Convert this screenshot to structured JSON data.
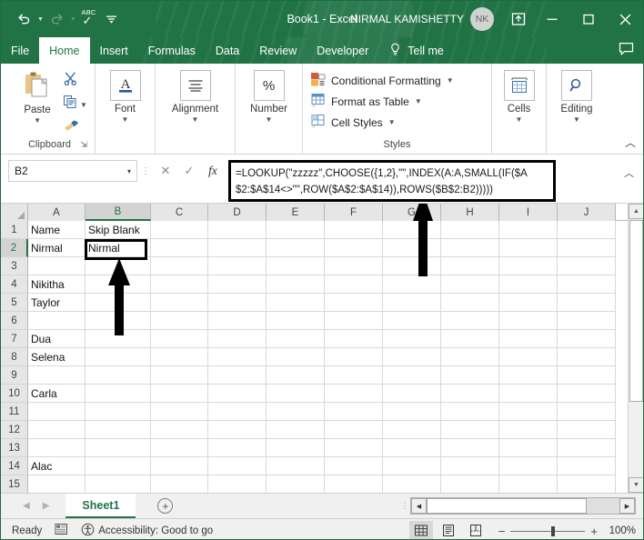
{
  "titlebar": {
    "quick_access": [
      {
        "name": "undo-icon",
        "glyph": "↰"
      },
      {
        "name": "redo-icon",
        "glyph": "↱"
      },
      {
        "name": "spelling-icon",
        "label_top": "ABC",
        "glyph": "✓"
      },
      {
        "name": "customize-quick-access-toolbar-icon",
        "glyph": "⩵"
      }
    ],
    "title": "Book1  -  Excel",
    "user_name": "NIRMAL KAMISHETTY",
    "avatar_initials": "NK",
    "ribbon_display_options": "▣",
    "minimize": "—",
    "maximize": "▢",
    "close": "✕"
  },
  "tabs": [
    {
      "label": "File",
      "active": false
    },
    {
      "label": "Home",
      "active": true
    },
    {
      "label": "Insert",
      "active": false
    },
    {
      "label": "Formulas",
      "active": false
    },
    {
      "label": "Data",
      "active": false
    },
    {
      "label": "Review",
      "active": false
    },
    {
      "label": "Developer",
      "active": false
    }
  ],
  "tellme": {
    "label": "Tell me",
    "icon": "lightbulb-icon"
  },
  "ribbon": {
    "clipboard": {
      "group_label": "Clipboard",
      "paste_label": "Paste",
      "cut_icon": "scissors-icon",
      "copy_icon": "copy-icon",
      "format_painter_icon": "format-painter-icon",
      "dialog_launcher": "⇲"
    },
    "font": {
      "group_label": "Font",
      "glyph": "A"
    },
    "alignment": {
      "group_label": "Alignment",
      "glyph": "≡"
    },
    "number": {
      "group_label": "Number",
      "glyph": "%"
    },
    "styles": {
      "group_label": "Styles",
      "items": [
        {
          "label": "Conditional Formatting",
          "icon": "conditional-formatting-icon"
        },
        {
          "label": "Format as Table",
          "icon": "format-as-table-icon"
        },
        {
          "label": "Cell Styles",
          "icon": "cell-styles-icon"
        }
      ]
    },
    "cells": {
      "group_label": "Cells",
      "label": "Cells",
      "icon": "cells-insert-icon"
    },
    "editing": {
      "group_label": "Editing",
      "label": "Editing",
      "icon": "find-select-icon"
    },
    "collapse": "︿"
  },
  "formula_bar": {
    "name_box": "B2",
    "name_box_caret": "▾",
    "cancel_icon": "✕",
    "enter_icon": "✓",
    "insert_function_icon": "fx",
    "formula": "=LOOKUP(\"zzzzz\",CHOOSE({1,2},\"\",INDEX(A:A,SMALL(IF($A$2:$A$14<>\"\",ROW($A$2:$A$14)),ROWS($B$2:B2)))))",
    "expand_icon": "︿"
  },
  "grid": {
    "columns": [
      "A",
      "B",
      "C",
      "D",
      "E",
      "F",
      "G",
      "H",
      "I",
      "J"
    ],
    "selected_column": "B",
    "selected_row": 2,
    "selected_cell": "B2",
    "rows": [
      {
        "num": "1",
        "A": "Name",
        "B": "Skip Blank"
      },
      {
        "num": "2",
        "A": "Nirmal",
        "B": "Nirmal"
      },
      {
        "num": "3",
        "A": "",
        "B": ""
      },
      {
        "num": "4",
        "A": "Nikitha",
        "B": ""
      },
      {
        "num": "5",
        "A": "Taylor",
        "B": ""
      },
      {
        "num": "6",
        "A": "",
        "B": ""
      },
      {
        "num": "7",
        "A": "Dua",
        "B": ""
      },
      {
        "num": "8",
        "A": "Selena",
        "B": ""
      },
      {
        "num": "9",
        "A": "",
        "B": ""
      },
      {
        "num": "10",
        "A": "Carla",
        "B": ""
      },
      {
        "num": "11",
        "A": "",
        "B": ""
      },
      {
        "num": "12",
        "A": "",
        "B": ""
      },
      {
        "num": "13",
        "A": "",
        "B": ""
      },
      {
        "num": "14",
        "A": "Alac",
        "B": ""
      },
      {
        "num": "15",
        "A": "",
        "B": ""
      }
    ]
  },
  "annotations": [
    {
      "name": "arrow-pointing-to-cell-b2",
      "direction": "up"
    },
    {
      "name": "arrow-pointing-to-formula-bar",
      "direction": "up"
    }
  ],
  "sheet_tabs": {
    "prev": "◀",
    "next": "▶",
    "sheets": [
      {
        "label": "Sheet1",
        "active": true
      }
    ],
    "add_sheet": "+"
  },
  "status_bar": {
    "status": "Ready",
    "macro_icon": "record-macro-icon",
    "accessibility": "Accessibility: Good to go",
    "views": [
      {
        "name": "normal-view-button",
        "glyph": "▦",
        "active": true
      },
      {
        "name": "page-layout-view-button",
        "glyph": "▤",
        "active": false
      },
      {
        "name": "page-break-preview-button",
        "glyph": "⊔",
        "active": false
      }
    ],
    "zoom_out": "−",
    "zoom_in": "+",
    "zoom_level": "100%"
  }
}
